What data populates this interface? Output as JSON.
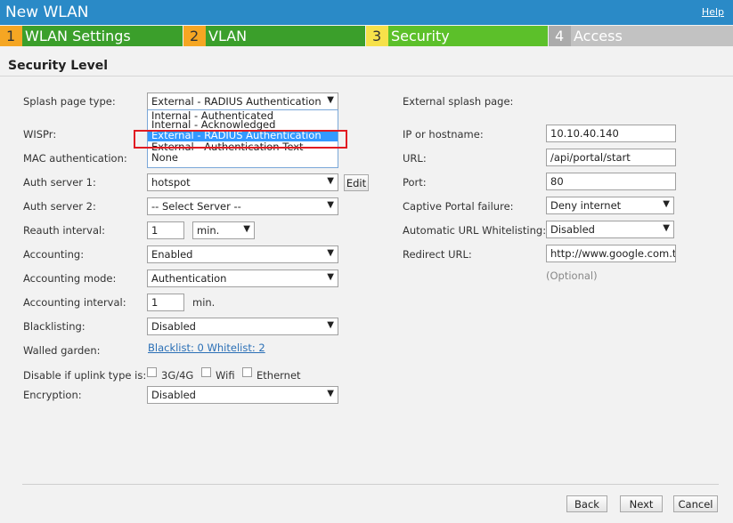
{
  "window": {
    "title": "New WLAN",
    "help": "Help"
  },
  "steps": [
    {
      "num": "1",
      "label": "WLAN Settings"
    },
    {
      "num": "2",
      "label": "VLAN"
    },
    {
      "num": "3",
      "label": "Security"
    },
    {
      "num": "4",
      "label": "Access"
    }
  ],
  "section": {
    "title": "Security Level"
  },
  "left": {
    "splash_label": "Splash page type:",
    "splash_value": "External - RADIUS Authentication",
    "splash_options": [
      "Internal - Authenticated",
      "Internal - Acknowledged",
      "External - RADIUS Authentication",
      "External - Authentication Text",
      "None"
    ],
    "wispr_label": "WISPr:",
    "mac_auth_label": "MAC authentication:",
    "auth1_label": "Auth server 1:",
    "auth1_value": "hotspot",
    "edit_label": "Edit",
    "auth2_label": "Auth server 2:",
    "auth2_value": "-- Select Server --",
    "reauth_label": "Reauth interval:",
    "reauth_value": "1",
    "reauth_unit": "min.",
    "accounting_label": "Accounting:",
    "accounting_value": "Enabled",
    "acct_mode_label": "Accounting mode:",
    "acct_mode_value": "Authentication",
    "acct_interval_label": "Accounting interval:",
    "acct_interval_value": "1",
    "acct_interval_unit": "min.",
    "blacklisting_label": "Blacklisting:",
    "blacklisting_value": "Disabled",
    "walled_label": "Walled garden:",
    "walled_link": "Blacklist: 0 Whitelist: 2",
    "uplink_label": "Disable if uplink type is:",
    "uplink_opt1": "3G/4G",
    "uplink_opt2": "Wifi",
    "uplink_opt3": "Ethernet",
    "encryption_label": "Encryption:",
    "encryption_value": "Disabled"
  },
  "right": {
    "ext_splash_label": "External splash page:",
    "ip_label": "IP or hostname:",
    "ip_value": "10.10.40.140",
    "url_label": "URL:",
    "url_value": "/api/portal/start",
    "port_label": "Port:",
    "port_value": "80",
    "cp_fail_label": "Captive Portal failure:",
    "cp_fail_value": "Deny internet",
    "auto_url_label": "Automatic URL Whitelisting:",
    "auto_url_value": "Disabled",
    "redirect_label": "Redirect URL:",
    "redirect_value": "http://www.google.com.tr",
    "optional_hint": "(Optional)"
  },
  "footer": {
    "back": "Back",
    "next": "Next",
    "cancel": "Cancel"
  }
}
